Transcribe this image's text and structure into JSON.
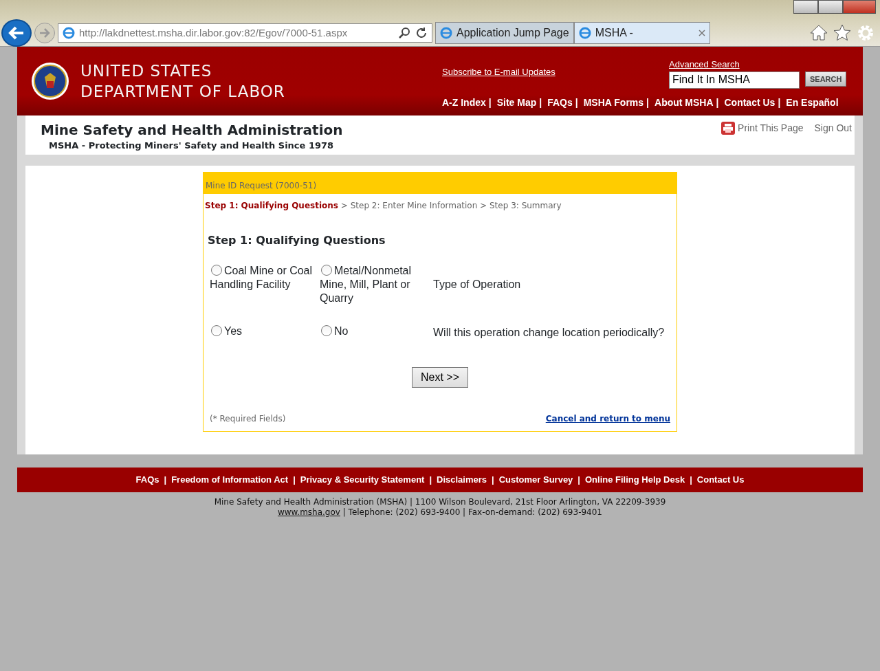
{
  "browser": {
    "address": "http://lakdnettest.msha.dir.labor.gov:82/Egov/7000-51.aspx",
    "tabs": [
      {
        "title": "Application Jump Page",
        "selected": false
      },
      {
        "title": "MSHA -",
        "selected": true
      }
    ]
  },
  "header": {
    "agency_line1": "UNITED STATES",
    "agency_line2": "DEPARTMENT OF LABOR",
    "subscribe_link": "Subscribe to E-mail Updates",
    "advanced_search_link": "Advanced Search",
    "search_value": "Find It In MSHA",
    "search_button": "SEARCH",
    "separator": "|",
    "nav_links": [
      "A-Z Index",
      "Site Map",
      "FAQs",
      "MSHA Forms",
      "About MSHA",
      "Contact Us",
      "En Español"
    ]
  },
  "subheader": {
    "title": "Mine Safety and Health Administration",
    "tagline": "MSHA - Protecting Miners' Safety and Health Since 1978",
    "print_link": "Print This Page",
    "sign_out_link": "Sign Out"
  },
  "form": {
    "title": "Mine ID Request (7000-51)",
    "step_separator": ">",
    "steps": [
      {
        "label": "Step 1: Qualifying Questions",
        "selected": true
      },
      {
        "label": "Step 2: Enter Mine Information",
        "selected": false
      },
      {
        "label": "Step 3: Summary",
        "selected": false
      }
    ],
    "heading": "Step 1: Qualifying Questions",
    "questions": [
      {
        "label": "Type of Operation",
        "options": [
          {
            "label": "Coal Mine or Coal Handling Facility",
            "selected": false
          },
          {
            "label": "Metal/Nonmetal Mine, Mill, Plant or Quarry",
            "selected": false
          }
        ]
      },
      {
        "label": "Will this operation change location periodically?",
        "options": [
          {
            "label": "Yes",
            "selected": false
          },
          {
            "label": "No",
            "selected": false
          }
        ]
      }
    ],
    "next_button": "Next >>",
    "required_note": "(* Required Fields)",
    "cancel_link": "Cancel and return to menu"
  },
  "footer": {
    "separator": "|",
    "links": [
      "FAQs",
      "Freedom of Information Act",
      "Privacy & Security Statement",
      "Disclaimers",
      "Customer Survey",
      "Online Filing Help Desk",
      "Contact Us"
    ],
    "address_line": "Mine Safety and Health Administration (MSHA) | 1100 Wilson Boulevard, 21st Floor Arlington, VA 22209-3939",
    "website_link": "www.msha.gov",
    "phone_text": "| Telephone: (202) 693-9400 | Fax-on-demand: (202) 693-9401"
  }
}
